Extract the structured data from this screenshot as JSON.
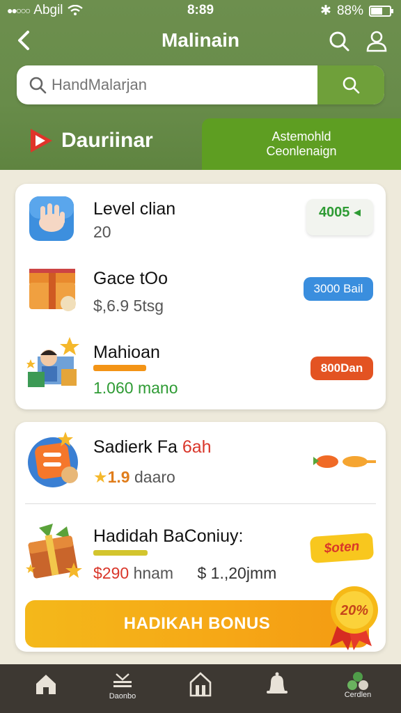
{
  "status_bar": {
    "carrier": "Abgil",
    "time": "8:89",
    "battery": "88%"
  },
  "nav": {
    "title": "Malinain"
  },
  "search": {
    "placeholder": "HandMalarjan"
  },
  "brand": {
    "name": "Dauriinar"
  },
  "promo_tab": {
    "line1": "Astemohld",
    "line2": "Ceonlenaign"
  },
  "list_items": [
    {
      "title": "Level clian",
      "subtitle": "20",
      "badge": "4005",
      "badge_color": "#2e9b34"
    },
    {
      "title": "Gace tOo",
      "subtitle": "$,6.9  5tsg",
      "badge": "3000 Bail",
      "badge_color": "#3a8ede"
    },
    {
      "title": "Mahioan",
      "subtitle": "1.060  mano",
      "badge": "800Dan",
      "badge_color": "#e35322"
    }
  ],
  "bonus_items": [
    {
      "title_black": "Sadierk Fa",
      "title_red": " 6ah",
      "rating": "1.9",
      "rating_text": "daaro"
    },
    {
      "title": "Hadidah BaConiuy:",
      "price": "$290",
      "price_unit": "hnam",
      "price2": "$ 1.,20jmm",
      "tag": "$oten"
    }
  ],
  "cta": {
    "label": "HADIKAH BONUS",
    "seal": "20%"
  },
  "tabbar": {
    "tab2": "Daonbo",
    "tab5": "Cerdlen"
  }
}
